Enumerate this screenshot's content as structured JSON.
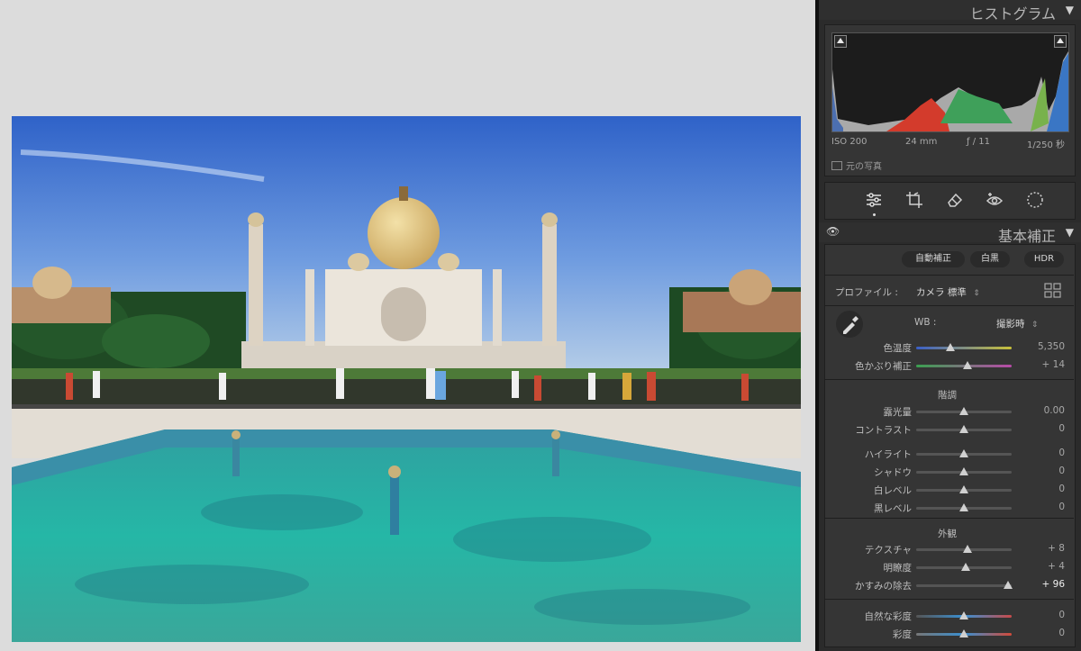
{
  "histogram": {
    "title": "ヒストグラム",
    "iso": "ISO 200",
    "focal": "24 mm",
    "aperture": "ƒ / 11",
    "shutter": "1/250 秒",
    "original_photo": "元の写真"
  },
  "basic": {
    "title": "基本補正",
    "auto_label": "自動補正",
    "bw_label": "白黒",
    "hdr_label": "HDR",
    "profile_label": "プロファイル :",
    "profile_value": "カメラ 標準",
    "wb_label": "WB :",
    "wb_value": "撮影時",
    "sliders_wb": [
      {
        "label": "色温度",
        "value": "5,350",
        "pos": 0.36
      },
      {
        "label": "色かぶり補正",
        "value": "+ 14",
        "pos": 0.54
      }
    ],
    "tone_title": "階調",
    "sliders_tone": [
      {
        "label": "露光量",
        "value": "0.00",
        "pos": 0.5
      },
      {
        "label": "コントラスト",
        "value": "0",
        "pos": 0.5
      },
      {
        "label": "ハイライト",
        "value": "0",
        "pos": 0.5
      },
      {
        "label": "シャドウ",
        "value": "0",
        "pos": 0.5
      },
      {
        "label": "白レベル",
        "value": "0",
        "pos": 0.5
      },
      {
        "label": "黒レベル",
        "value": "0",
        "pos": 0.5
      }
    ],
    "presence_title": "外観",
    "sliders_presence": [
      {
        "label": "テクスチャ",
        "value": "+ 8",
        "pos": 0.54
      },
      {
        "label": "明瞭度",
        "value": "+ 4",
        "pos": 0.52
      },
      {
        "label": "かすみの除去",
        "value": "+ 96",
        "pos": 0.96
      }
    ],
    "sliders_color": [
      {
        "label": "自然な彩度",
        "value": "0",
        "pos": 0.5
      },
      {
        "label": "彩度",
        "value": "0",
        "pos": 0.5
      }
    ]
  },
  "colors": {
    "panel_bg": "#2b2b2b",
    "canvas_bg": "#dcdcdc"
  }
}
